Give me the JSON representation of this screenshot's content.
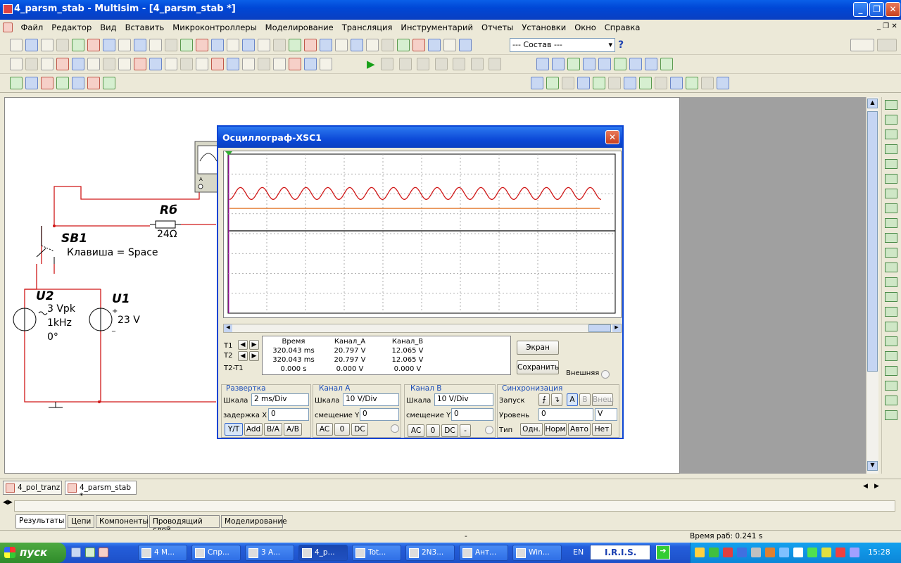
{
  "window": {
    "title": "4_parsm_stab - Multisim - [4_parsm_stab *]",
    "min_icon": "minimize-icon",
    "max_icon": "maximize-icon",
    "close_icon": "close-icon"
  },
  "menu": {
    "items": [
      "Файл",
      "Редактор",
      "Вид",
      "Вставить",
      "Микроконтроллеры",
      "Моделирование",
      "Трансляция",
      "Инструментарий",
      "Отчеты",
      "Установки",
      "Окно",
      "Справка"
    ]
  },
  "toolbar": {
    "composition_select": "--- Состав ---"
  },
  "schematic": {
    "rb_label": "Rб",
    "rb_value": "24Ω",
    "sb1_label": "SB1",
    "sb1_key": "Клавиша = Space",
    "u2_label": "U2",
    "u2_vpk": "3 Vpk",
    "u2_freq": "1kHz",
    "u2_phase": "0°",
    "u1_label": "U1",
    "u1_value": "23 V",
    "scope_pin_a": "A"
  },
  "scope": {
    "title": "Осциллограф-XSC1",
    "readout": {
      "headers": [
        "Время",
        "Канал_A",
        "Канал_B"
      ],
      "t1_label": "T1",
      "t2_label": "T2",
      "t2t1_label": "T2-T1",
      "t1": [
        "320.043 ms",
        "20.797 V",
        "12.065 V"
      ],
      "t2": [
        "320.043 ms",
        "20.797 V",
        "12.065 V"
      ],
      "diff": [
        "0.000 s",
        "0.000 V",
        "0.000 V"
      ]
    },
    "buttons": {
      "screen": "Экран",
      "save": "Сохранить",
      "external": "Внешняя"
    },
    "sweep": {
      "title": "Развертка",
      "scale_label": "Шкала",
      "scale_value": "2 ms/Div",
      "delay_label": "задержка X",
      "delay_value": "0",
      "modes": [
        "Y/T",
        "Add",
        "B/A",
        "A/B"
      ]
    },
    "channel_a": {
      "title": "Канал А",
      "scale_label": "Шкала",
      "scale_value": "10  V/Div",
      "offset_label": "смещение Y",
      "offset_value": "0",
      "coupling": [
        "AC",
        "0",
        "DC"
      ]
    },
    "channel_b": {
      "title": "Канал В",
      "scale_label": "Шкала",
      "scale_value": "10  V/Div",
      "offset_label": "смещение Y",
      "offset_value": "0",
      "coupling": [
        "AC",
        "0",
        "DC",
        "-"
      ]
    },
    "sync": {
      "title": "Синхронизация",
      "trigger_label": "Запуск",
      "sources": [
        "A",
        "B",
        "Внеш"
      ],
      "level_label": "Уровень",
      "level_value": "0",
      "level_unit": "V",
      "type_label": "Тип",
      "types": [
        "Одн.",
        "Норм",
        "Авто",
        "Нет"
      ]
    },
    "chart_data": {
      "type": "line",
      "x_divisions": 10,
      "y_divisions": 8,
      "series": [
        {
          "name": "Канал_A",
          "color": "#d01818",
          "kind": "sine",
          "center_div": 2.0,
          "amplitude_div": 0.3,
          "cycles": 17
        },
        {
          "name": "Канал_B",
          "color": "#e07020",
          "kind": "flat",
          "center_div": 1.2
        }
      ],
      "zero_line_color": "#000000",
      "cursor_color": "#d020d0"
    }
  },
  "doc_tabs": [
    "4_pol_tranz",
    "4_parsm_stab *"
  ],
  "result_tabs": [
    "Результаты",
    "Цепи",
    "Компоненты",
    "Проводящий слой",
    "Моделирование"
  ],
  "status": {
    "dash": "-",
    "sim_time": "Время раб: 0.241 s"
  },
  "taskbar": {
    "start": "пуск",
    "tasks": [
      "4 M...",
      "Спр...",
      "3 A...",
      "4_p...",
      "Tot...",
      "2N3...",
      "Ант...",
      "Win..."
    ],
    "lang": "EN",
    "iris": "I.R.I.S.",
    "clock": "15:28"
  }
}
